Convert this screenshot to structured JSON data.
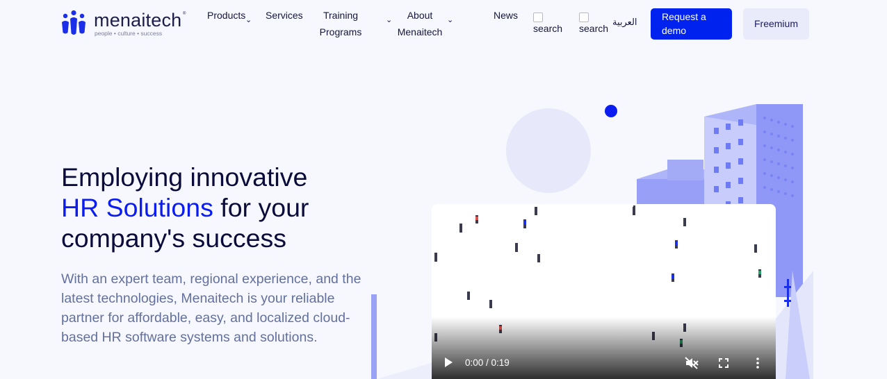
{
  "header": {
    "logo": {
      "word": "menaitech",
      "tagline": "people  •  culture  •  success",
      "tm": "®"
    },
    "nav": {
      "products": "Products",
      "services": "Services",
      "training_line1": "Training",
      "training_line2": "Programs",
      "about_line1": "About",
      "about_line2": "Menaitech",
      "news": "News"
    },
    "search_alt_1": "search",
    "search_alt_2": "search",
    "language": "العربية",
    "request_demo": "Request a demo",
    "freemium": "Freemium",
    "chevron": "⌄"
  },
  "hero": {
    "title_line1": "Employing innovative",
    "title_accent": "HR Solutions",
    "title_rest": " for your",
    "title_line3": "company's success",
    "description": "With an expert team, regional experience, and the latest technologies, Menaitech is your reliable partner for affordable, easy, and localized cloud-based HR software systems and solutions."
  },
  "video": {
    "time": "0:00 / 0:19",
    "progress": 0
  },
  "colors": {
    "accent": "#0a1cf0",
    "button": "#0022ee",
    "building": "#8f98f7",
    "background": "#f7f8fe"
  }
}
